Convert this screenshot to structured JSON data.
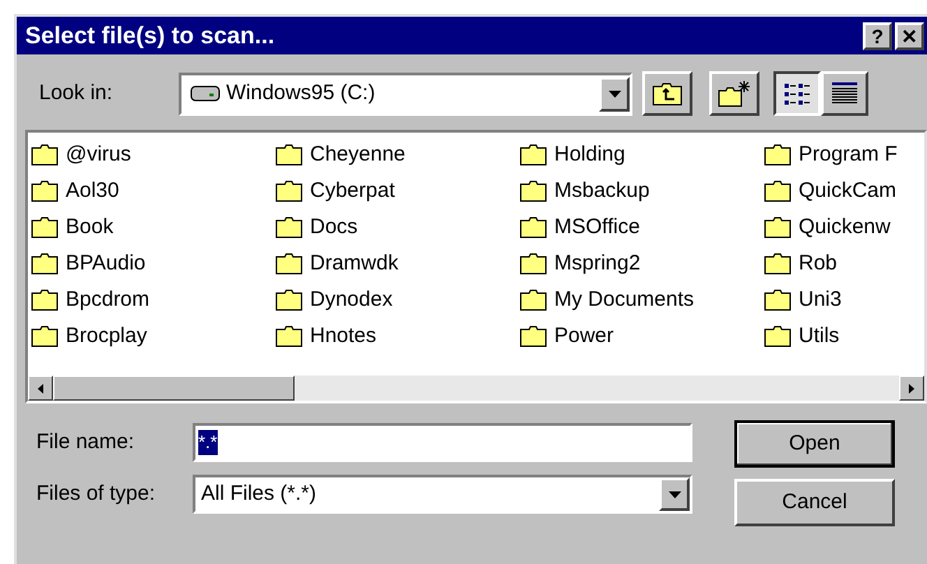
{
  "window": {
    "title": "Select file(s) to scan...",
    "title_buttons": [
      "?",
      "✕"
    ]
  },
  "look_in": {
    "label": "Look in:",
    "value": "Windows95 (C:)"
  },
  "view_buttons": [
    {
      "kind": "list",
      "selected": true
    },
    {
      "kind": "details",
      "selected": false
    }
  ],
  "folders": [
    [
      "@virus",
      "Aol30",
      "Book",
      "BPAudio",
      "Bpcdrom",
      "Brocplay"
    ],
    [
      "Cheyenne",
      "Cyberpat",
      "Docs",
      "Dramwdk",
      "Dynodex",
      "Hnotes"
    ],
    [
      "Holding",
      "Msbackup",
      "MSOffice",
      "Mspring2",
      "My Documents",
      "Power"
    ],
    [
      "Program F",
      "QuickCam",
      "Quickenw",
      "Rob",
      "Uni3",
      "Utils"
    ]
  ],
  "file_name": {
    "label": "File name:",
    "value": "*.*"
  },
  "file_type": {
    "label": "Files of type:",
    "value": "All Files (*.*)"
  },
  "buttons": [
    {
      "label": "Open",
      "default": true
    },
    {
      "label": "Cancel",
      "default": false
    }
  ]
}
